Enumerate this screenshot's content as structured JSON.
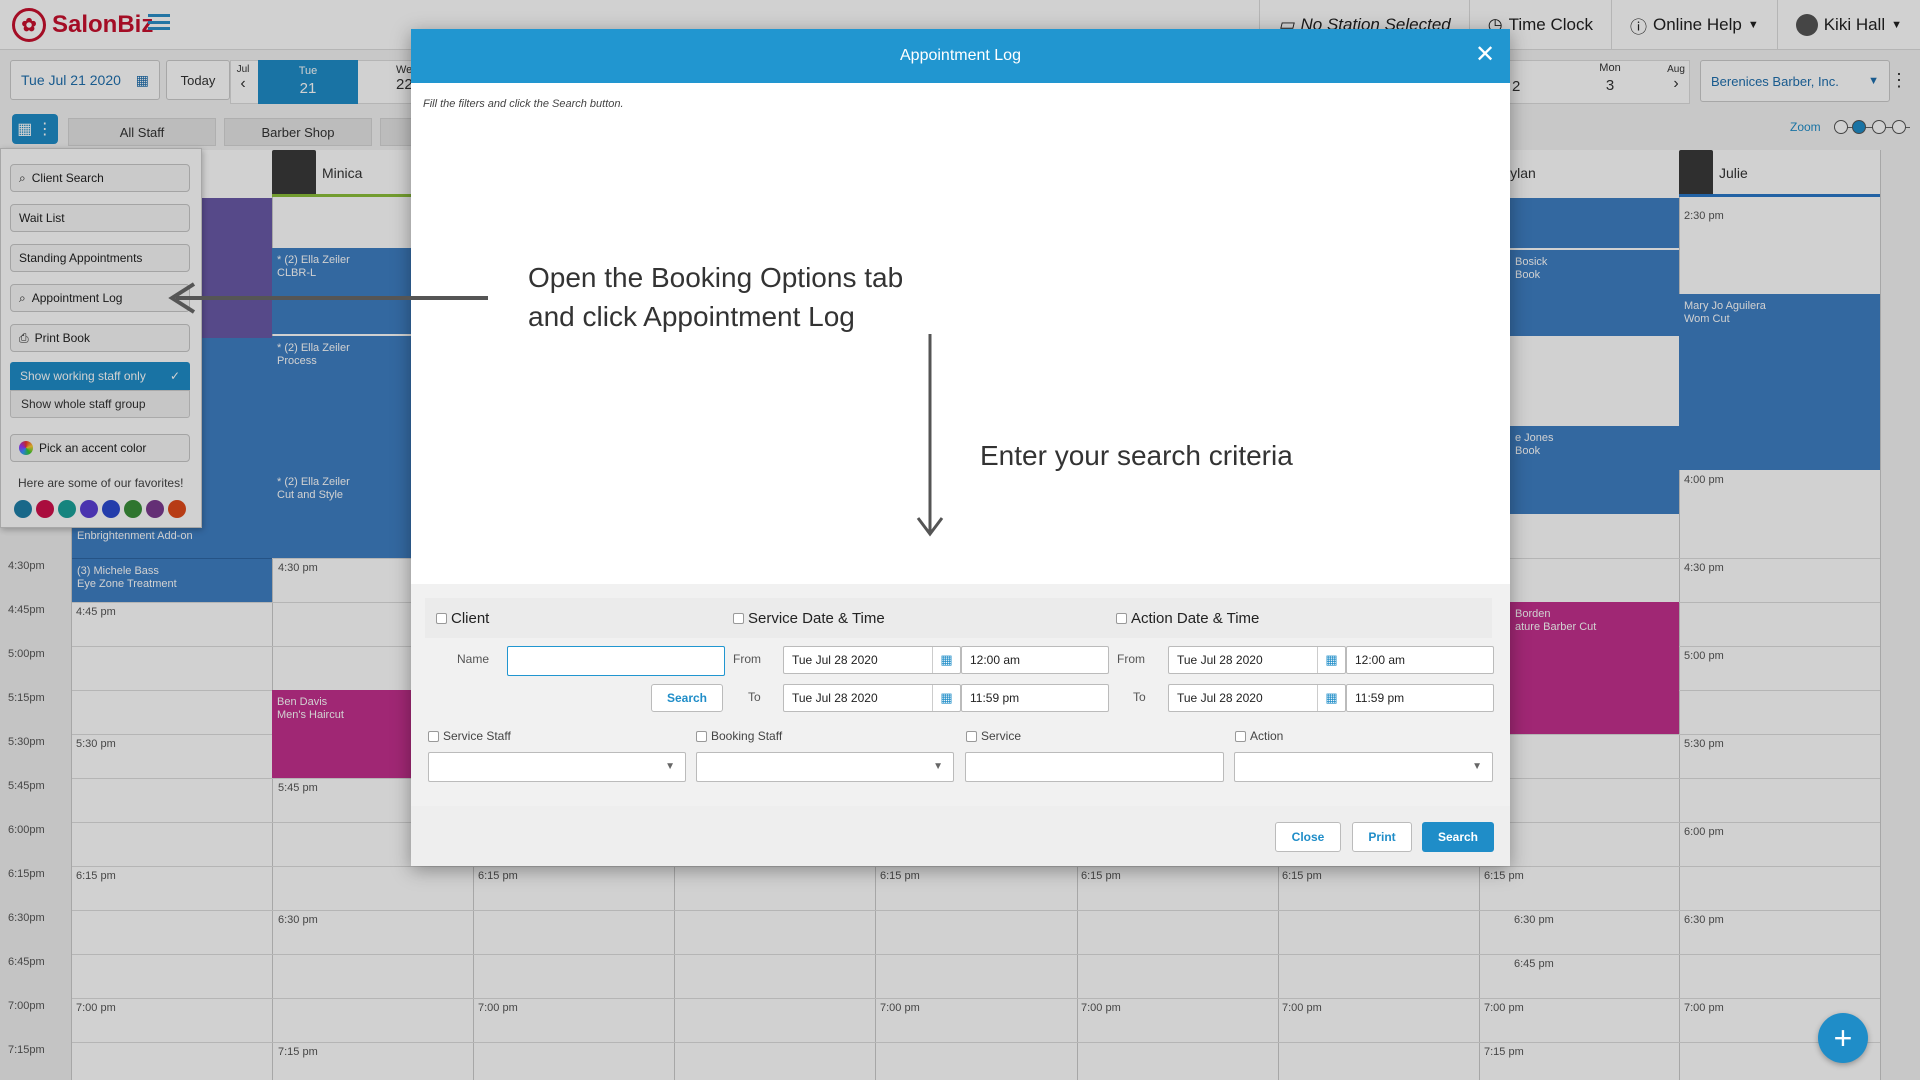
{
  "app": {
    "brand": "SalonBiz"
  },
  "topnav": {
    "station": "No Station Selected",
    "time_clock": "Time Clock",
    "online_help": "Online Help",
    "user": "Kiki Hall"
  },
  "datebar": {
    "date": "Tue Jul 21 2020",
    "today": "Today",
    "prev_month": "Jul",
    "sel_dow": "Tue",
    "sel_day": "21",
    "next_partial": "We",
    "next_day_partial": "22",
    "far_day_partial": "2",
    "mon_dow": "Mon",
    "mon_day": "3",
    "next_month": "Aug",
    "company": "Berenices Barber, Inc."
  },
  "tabs": {
    "all_staff": "All Staff",
    "barber_shop": "Barber Shop",
    "zoom": "Zoom"
  },
  "sidemenu": {
    "client_search": "Client Search",
    "wait_list": "Wait List",
    "standing": "Standing Appointments",
    "appt_log": "Appointment Log",
    "print_book": "Print Book",
    "working_only": "Show working staff only",
    "whole_group": "Show whole staff group",
    "accent": "Pick an accent color",
    "favorites": "Here are some of our favorites!",
    "swatches": [
      "#1f7fa8",
      "#d0104c",
      "#1aa19a",
      "#5b3fd6",
      "#2d4bd1",
      "#3a8f3a",
      "#7a3a8f",
      "#e04a1a"
    ]
  },
  "times": [
    "4:30pm",
    "4:45pm",
    "5:00pm",
    "5:15pm",
    "5:30pm",
    "5:45pm",
    "6:00pm",
    "6:15pm",
    "6:30pm",
    "6:45pm",
    "7:00pm",
    "7:15pm"
  ],
  "staff": {
    "minica": "Minica",
    "dylan": "Dylan",
    "julie": "Julie"
  },
  "appointments": {
    "ella1_name": "* (2) Ella Zeiler",
    "ella1_svc": "CLBR-L",
    "ella2_name": "* (2) Ella Zeiler",
    "ella2_svc": "Process",
    "ella3_name": "* (2) Ella Zeiler",
    "ella3_svc": "Cut and Style",
    "enbright": "Enbrightenment Add-on",
    "michele_name": "(3) Michele Bass",
    "michele_svc": "Eye Zone Treatment",
    "ben_name": "Ben Davis",
    "ben_svc": "Men's Haircut",
    "bosick_name": "Bosick",
    "bosick_svc": "Book",
    "jones_name": "e Jones",
    "jones_svc": "Book",
    "borden_name": "Borden",
    "borden_svc": "ature Barber Cut",
    "maryjo_name": "Mary Jo Aguilera",
    "maryjo_svc": "Wom Cut"
  },
  "cell_times": {
    "t445": "4:45 pm",
    "t430": "4:30 pm",
    "t530": "5:30 pm",
    "t545": "5:45 pm",
    "t615": "6:15 pm",
    "t630": "6:30 pm",
    "t645": "6:45 pm",
    "t700": "7:00 pm",
    "t715": "7:15 pm",
    "t230": "2:30 pm",
    "t400": "4:00 pm",
    "t500": "5:00 pm",
    "t600": "6:00 pm",
    "pm": "pm",
    "om": "om"
  },
  "modal": {
    "title": "Appointment Log",
    "hint": "Fill the filters and click the Search button.",
    "annotation1_line1": "Open the Booking Options tab",
    "annotation1_line2": "and click Appointment Log",
    "annotation2": "Enter your search criteria",
    "client": "Client",
    "service_dt": "Service Date & Time",
    "action_dt": "Action Date & Time",
    "name_label": "Name",
    "name_value": "",
    "search_small": "Search",
    "from": "From",
    "to": "To",
    "svc_from_date": "Tue Jul 28 2020",
    "svc_from_time": "12:00 am",
    "svc_to_date": "Tue Jul 28 2020",
    "svc_to_time": "11:59 pm",
    "act_from_date": "Tue Jul 28 2020",
    "act_from_time": "12:00 am",
    "act_to_date": "Tue Jul 28 2020",
    "act_to_time": "11:59 pm",
    "service_staff": "Service Staff",
    "booking_staff": "Booking Staff",
    "service": "Service",
    "action": "Action",
    "close": "Close",
    "print": "Print",
    "search": "Search"
  },
  "colors": {
    "primary": "#2196d0",
    "brand": "#c8102e",
    "appt_blue": "#3f7fc4",
    "appt_magenta": "#c4308e",
    "appt_purple": "#6a5aa8"
  }
}
